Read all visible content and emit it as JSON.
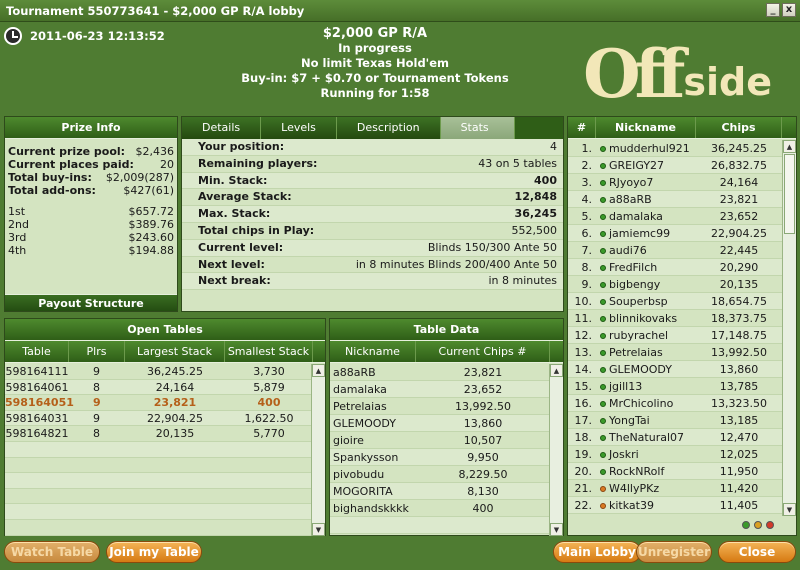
{
  "window": {
    "title": "Tournament 550773641 - $2,000 GP R/A lobby",
    "min_label": "_",
    "close_label": "x"
  },
  "header": {
    "datetime": "2011-06-23 12:13:52",
    "lines": [
      "$2,000 GP R/A",
      "In progress",
      "No limit Texas Hold'em",
      "Buy-in: $7 + $0.70 or Tournament Tokens",
      "Running for 1:58"
    ],
    "logo_big": "Off",
    "logo_small": "side"
  },
  "prize": {
    "title": "Prize Info",
    "rows": [
      {
        "label": "Current prize pool:",
        "value": "$2,436"
      },
      {
        "label": "Current places paid:",
        "value": "20"
      },
      {
        "label": "Total buy-ins:",
        "value": "$2,009(287)"
      },
      {
        "label": "Total add-ons:",
        "value": "$427(61)"
      }
    ],
    "places": [
      {
        "label": "1st",
        "value": "$657.72"
      },
      {
        "label": "2nd",
        "value": "$389.76"
      },
      {
        "label": "3rd",
        "value": "$243.60"
      },
      {
        "label": "4th",
        "value": "$194.88"
      }
    ],
    "payout_button": "Payout Structure"
  },
  "tabs": [
    {
      "label": "Details"
    },
    {
      "label": "Levels"
    },
    {
      "label": "Description"
    },
    {
      "label": "Stats"
    }
  ],
  "stats": [
    {
      "label": "Your position:",
      "value": "4"
    },
    {
      "label": "Remaining players:",
      "value": "43 on 5 tables"
    },
    {
      "label": "Min. Stack:",
      "value": "400"
    },
    {
      "label": "Average Stack:",
      "value": "12,848"
    },
    {
      "label": "Max. Stack:",
      "value": "36,245"
    },
    {
      "label": "Total chips in Play:",
      "value": "552,500"
    },
    {
      "label": "Current level:",
      "value": "Blinds 150/300 Ante 50"
    },
    {
      "label": "Next level:",
      "value": "in 8 minutes Blinds 200/400 Ante 50"
    },
    {
      "label": "Next break:",
      "value": "in 8 minutes"
    }
  ],
  "players": {
    "headers": [
      "#",
      "Nickname",
      "Chips"
    ],
    "rows": [
      {
        "n": "1.",
        "nick": "mudderhul921",
        "chips": "36,245.25",
        "status": "green"
      },
      {
        "n": "2.",
        "nick": "GREIGY27",
        "chips": "26,832.75",
        "status": "green"
      },
      {
        "n": "3.",
        "nick": "RJyoyo7",
        "chips": "24,164",
        "status": "green"
      },
      {
        "n": "4.",
        "nick": "a88aRB",
        "chips": "23,821",
        "status": "green"
      },
      {
        "n": "5.",
        "nick": "damalaka",
        "chips": "23,652",
        "status": "green"
      },
      {
        "n": "6.",
        "nick": "jamiemc99",
        "chips": "22,904.25",
        "status": "green"
      },
      {
        "n": "7.",
        "nick": "audi76",
        "chips": "22,445",
        "status": "green"
      },
      {
        "n": "8.",
        "nick": "FredFilch",
        "chips": "20,290",
        "status": "green"
      },
      {
        "n": "9.",
        "nick": "bigbengy",
        "chips": "20,135",
        "status": "green"
      },
      {
        "n": "10.",
        "nick": "Souperbsp",
        "chips": "18,654.75",
        "status": "green"
      },
      {
        "n": "11.",
        "nick": "blinnikovaks",
        "chips": "18,373.75",
        "status": "green"
      },
      {
        "n": "12.",
        "nick": "rubyrachel",
        "chips": "17,148.75",
        "status": "green"
      },
      {
        "n": "13.",
        "nick": "Petrelaias",
        "chips": "13,992.50",
        "status": "green"
      },
      {
        "n": "14.",
        "nick": "GLEMOODY",
        "chips": "13,860",
        "status": "green"
      },
      {
        "n": "15.",
        "nick": "jgill13",
        "chips": "13,785",
        "status": "green"
      },
      {
        "n": "16.",
        "nick": "MrChicolino",
        "chips": "13,323.50",
        "status": "green"
      },
      {
        "n": "17.",
        "nick": "YongTai",
        "chips": "13,185",
        "status": "green"
      },
      {
        "n": "18.",
        "nick": "TheNatural07",
        "chips": "12,470",
        "status": "green"
      },
      {
        "n": "19.",
        "nick": "Joskri",
        "chips": "12,025",
        "status": "green"
      },
      {
        "n": "20.",
        "nick": "RockNRolf",
        "chips": "11,950",
        "status": "green"
      },
      {
        "n": "21.",
        "nick": "W4llyPKz",
        "chips": "11,420",
        "status": "orange"
      },
      {
        "n": "22.",
        "nick": "kitkat39",
        "chips": "11,405",
        "status": "orange"
      }
    ],
    "status_colors": [
      "#3b9a2a",
      "#d9a023",
      "#d23a2a"
    ]
  },
  "open_tables": {
    "title": "Open Tables",
    "headers": [
      "Table",
      "Plrs",
      "Largest Stack",
      "Smallest Stack"
    ],
    "rows": [
      {
        "table": "598164111",
        "plrs": "9",
        "largest": "36,245.25",
        "smallest": "3,730",
        "selected": false
      },
      {
        "table": "598164061",
        "plrs": "8",
        "largest": "24,164",
        "smallest": "5,879",
        "selected": false
      },
      {
        "table": "598164051",
        "plrs": "9",
        "largest": "23,821",
        "smallest": "400",
        "selected": true
      },
      {
        "table": "598164031",
        "plrs": "9",
        "largest": "22,904.25",
        "smallest": "1,622.50",
        "selected": false
      },
      {
        "table": "598164821",
        "plrs": "8",
        "largest": "20,135",
        "smallest": "5,770",
        "selected": false
      }
    ]
  },
  "table_data": {
    "title": "Table Data",
    "headers": [
      "Nickname",
      "Current Chips #"
    ],
    "rows": [
      {
        "nick": "a88aRB",
        "chips": "23,821"
      },
      {
        "nick": "damalaka",
        "chips": "23,652"
      },
      {
        "nick": "Petrelaias",
        "chips": "13,992.50"
      },
      {
        "nick": "GLEMOODY",
        "chips": "13,860"
      },
      {
        "nick": "gioire",
        "chips": "10,507"
      },
      {
        "nick": "Spankysson",
        "chips": "9,950"
      },
      {
        "nick": "pivobudu",
        "chips": "8,229.50"
      },
      {
        "nick": "MOGORITA",
        "chips": "8,130"
      },
      {
        "nick": "bighandskkkk",
        "chips": "400"
      }
    ]
  },
  "buttons": {
    "watch": "Watch Table",
    "join": "Join my Table",
    "lobby": "Main Lobby",
    "unregister": "Unregister",
    "close": "Close"
  }
}
